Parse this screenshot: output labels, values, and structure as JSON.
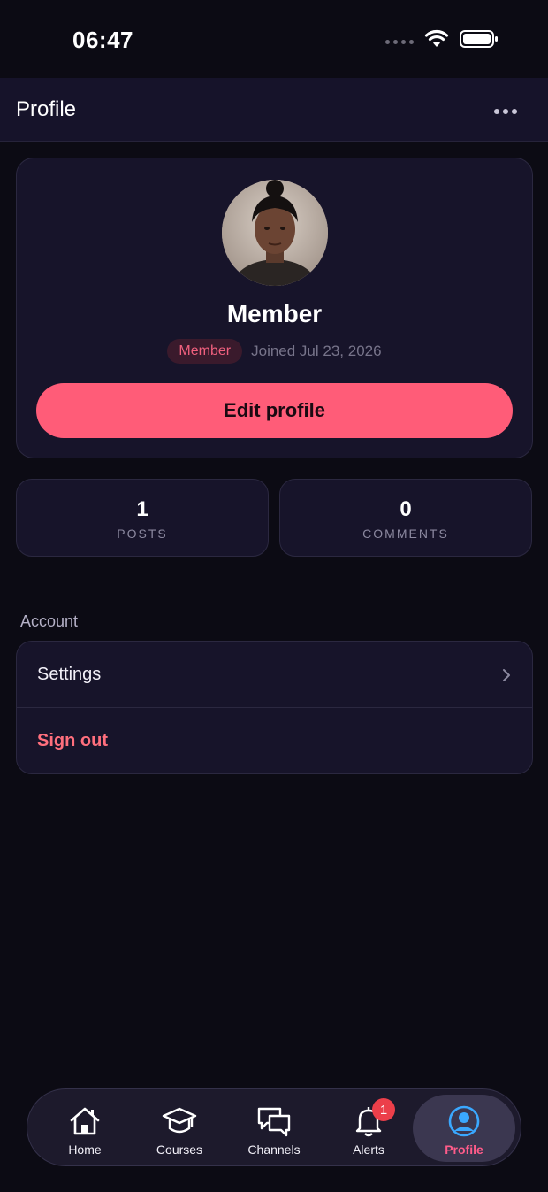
{
  "status_bar": {
    "time": "06:47"
  },
  "app_bar": {
    "title": "Profile"
  },
  "profile": {
    "name": "Member",
    "role_badge": "Member",
    "joined": "Joined Jul 23, 2026",
    "edit_button": "Edit profile"
  },
  "stats": {
    "posts": {
      "value": "1",
      "label": "POSTS"
    },
    "comments": {
      "value": "0",
      "label": "COMMENTS"
    }
  },
  "account": {
    "section_label": "Account",
    "settings_label": "Settings",
    "signout_label": "Sign out"
  },
  "bottom_nav": {
    "items": [
      {
        "label": "Home",
        "icon": "home-icon"
      },
      {
        "label": "Courses",
        "icon": "graduation-cap-icon"
      },
      {
        "label": "Channels",
        "icon": "chat-bubbles-icon"
      },
      {
        "label": "Alerts",
        "icon": "bell-icon",
        "badge": "1"
      },
      {
        "label": "Profile",
        "icon": "user-circle-icon",
        "active": true
      }
    ]
  },
  "colors": {
    "accent": "#ff5c78",
    "background": "#0c0b14",
    "card": "#17142a",
    "signout": "#ff6f7d",
    "active_icon": "#3aa8ff"
  }
}
